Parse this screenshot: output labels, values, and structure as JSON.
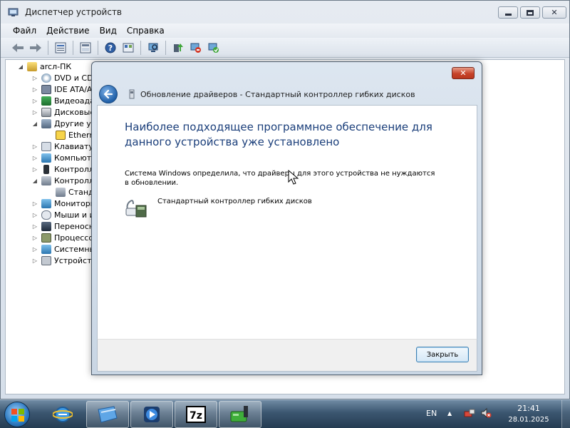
{
  "window": {
    "title": "Диспетчер устройств",
    "menu": [
      "Файл",
      "Действие",
      "Вид",
      "Справка"
    ]
  },
  "toolbar": {
    "icons": [
      "back-icon",
      "forward-icon",
      "properties-icon",
      "show-hidden-icon",
      "help-icon",
      "view-icon",
      "scan-hardware-icon",
      "update-driver-icon",
      "disable-device-icon",
      "uninstall-device-icon"
    ]
  },
  "tree": {
    "root": "arcл-ПК",
    "items": [
      {
        "label": "DVD и CD",
        "expander": "▷"
      },
      {
        "label": "IDE ATA/A",
        "expander": "▷"
      },
      {
        "label": "Видеоада",
        "expander": "▷"
      },
      {
        "label": "Дисковые",
        "expander": "▷"
      },
      {
        "label": "Другие ус",
        "expander": "◢"
      },
      {
        "label": "Etherne",
        "expander": ""
      },
      {
        "label": "Клавиатур",
        "expander": "▷"
      },
      {
        "label": "Компьюте",
        "expander": "▷"
      },
      {
        "label": "Контролле",
        "expander": "▷"
      },
      {
        "label": "Контролле",
        "expander": "◢"
      },
      {
        "label": "Станд",
        "expander": ""
      },
      {
        "label": "Мониторы",
        "expander": "▷"
      },
      {
        "label": "Мыши и ин",
        "expander": "▷"
      },
      {
        "label": "Переносн",
        "expander": "▷"
      },
      {
        "label": "Процессор",
        "expander": "▷"
      },
      {
        "label": "Системны",
        "expander": "▷"
      },
      {
        "label": "Устройств",
        "expander": "▷"
      }
    ]
  },
  "dialog": {
    "title": "Обновление драйверов - Стандартный контроллер гибких дисков",
    "heading": "Наиболее подходящее программное обеспечение для данного устройства уже установлено",
    "message": "Система Windows определила, что драйверы для этого устройства не нуждаются в обновлении.",
    "device_name": "Стандартный контроллер гибких дисков",
    "close_button": "Закрыть"
  },
  "taskbar": {
    "language": "EN",
    "time": "21:41",
    "date": "28.01.2025"
  },
  "colors": {
    "heading": "#1a3e7a",
    "dialog_close": "#c74329",
    "taskbar": "#3b5670"
  }
}
